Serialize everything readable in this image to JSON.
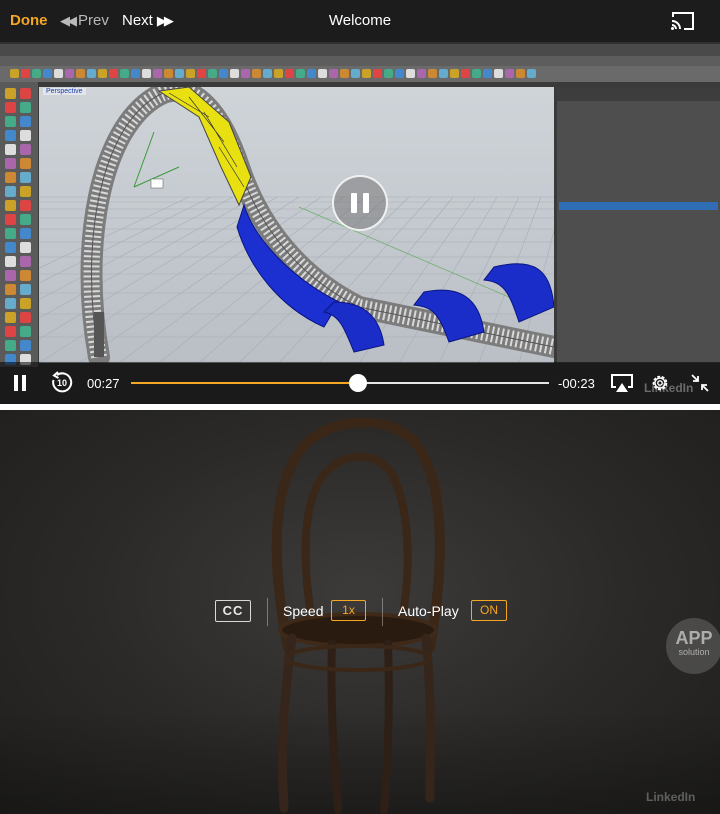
{
  "header": {
    "done_label": "Done",
    "prev_label": "Prev",
    "next_label": "Next",
    "title": "Welcome"
  },
  "video": {
    "viewport_label": "Perspective",
    "progress_fraction": 0.544
  },
  "controls": {
    "rewind_seconds": "10",
    "elapsed": "00:27",
    "remaining": "-00:23"
  },
  "settings": {
    "cc_label": "CC",
    "speed_label": "Speed",
    "speed_value": "1x",
    "autoplay_label": "Auto-Play",
    "autoplay_value": "ON"
  },
  "branding": {
    "linkedin": "LinkedIn",
    "watermark_line1": "APP",
    "watermark_line2": "solution"
  },
  "colors": {
    "accent": "#f5a623",
    "track": "#e6e6e6"
  }
}
